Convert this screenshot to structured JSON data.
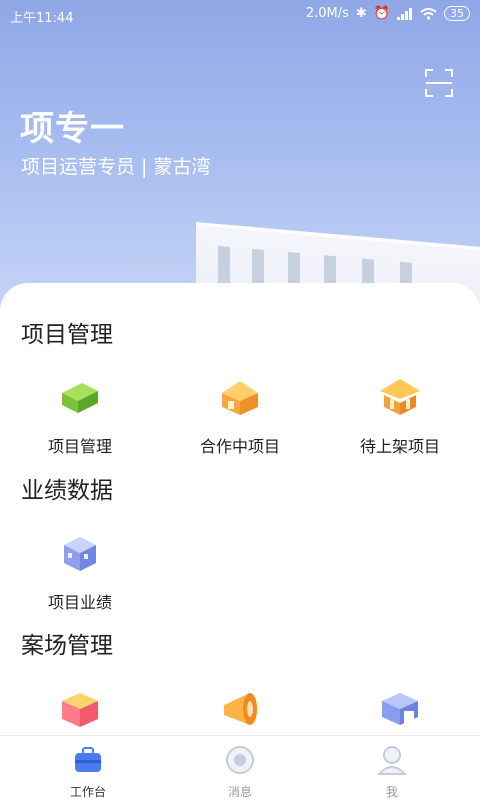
{
  "status_bar": {
    "time": "上午11:44",
    "net_speed": "2.0M/s",
    "battery": "35"
  },
  "profile": {
    "name": "项专一",
    "role": "项目运营专员 | 蒙古湾"
  },
  "sections": [
    {
      "title": "项目管理",
      "items": [
        {
          "label": "项目管理"
        },
        {
          "label": "合作中项目"
        },
        {
          "label": "待上架项目"
        }
      ]
    },
    {
      "title": "业绩数据",
      "items": [
        {
          "label": "项目业绩"
        }
      ]
    },
    {
      "title": "案场管理",
      "items": []
    }
  ],
  "tabbar": {
    "tabs": [
      {
        "label": "工作台"
      },
      {
        "label": "消息"
      },
      {
        "label": "我"
      }
    ],
    "active": "工作台"
  },
  "colors": {
    "accent": "#4a7bf0",
    "hero_top": "#8fa7e6"
  }
}
